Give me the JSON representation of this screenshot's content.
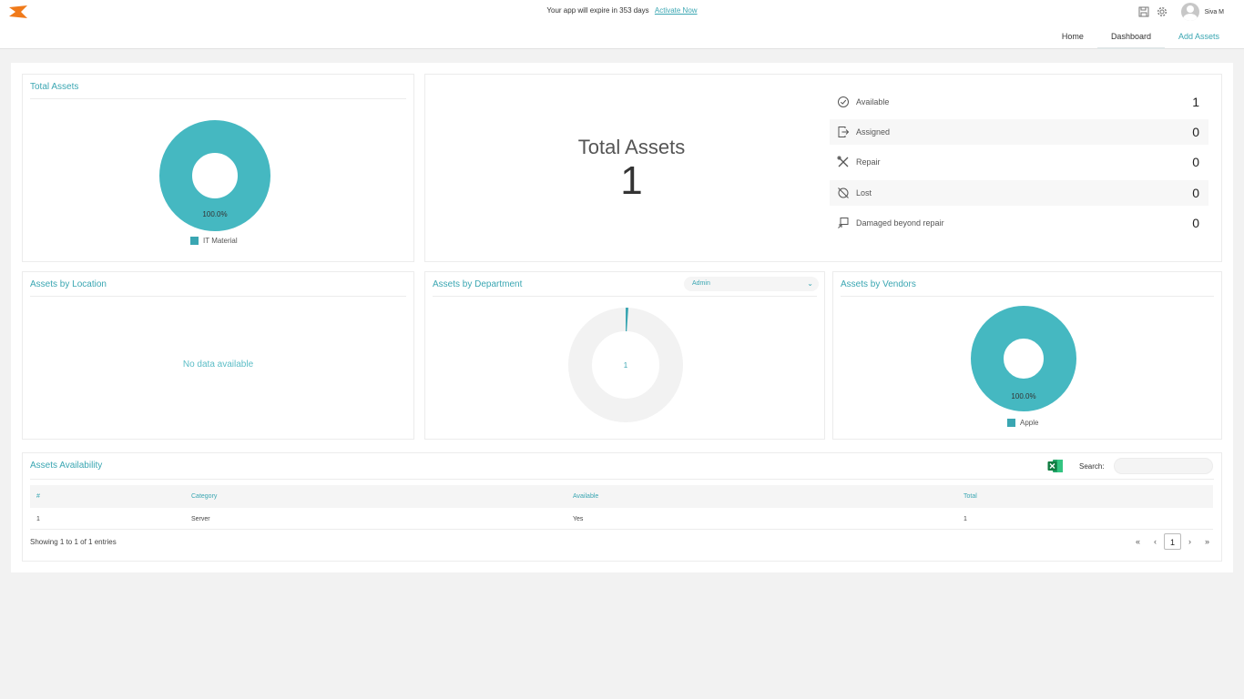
{
  "topbar": {
    "expire_text": "Your app will expire in 353 days",
    "activate_link": "Activate Now",
    "user_name": "Siva M",
    "icons": [
      "logo-icon",
      "save-icon",
      "gear-icon",
      "avatar"
    ]
  },
  "nav": {
    "home": "Home",
    "dashboard": "Dashboard",
    "add_assets": "Add Assets"
  },
  "colors": {
    "accent": "#3aa6b2",
    "donut_fill": "#45b8c1",
    "donut_track": "#f2f2f2"
  },
  "total_assets_card": {
    "title": "Total Assets",
    "pie_label": "100.0%",
    "legend": "IT Material"
  },
  "summary": {
    "title": "Total Assets",
    "count": "1",
    "statuses": [
      {
        "label": "Available",
        "value": "1",
        "icon": "check-circle-icon"
      },
      {
        "label": "Assigned",
        "value": "0",
        "icon": "assign-icon"
      },
      {
        "label": "Repair",
        "value": "0",
        "icon": "tools-icon"
      },
      {
        "label": "Lost",
        "value": "0",
        "icon": "lost-icon"
      },
      {
        "label": "Damaged beyond repair",
        "value": "0",
        "icon": "damaged-icon"
      }
    ]
  },
  "location_card": {
    "title": "Assets by Location",
    "empty_text": "No data available"
  },
  "department_card": {
    "title": "Assets by Department",
    "selected": "Admin",
    "center_value": "1"
  },
  "vendors_card": {
    "title": "Assets by Vendors",
    "pie_label": "100.0%",
    "legend": "Apple"
  },
  "availability": {
    "title": "Assets Availability",
    "search_label": "Search:",
    "search_value": "",
    "columns": [
      "#",
      "Category",
      "Available",
      "Total"
    ],
    "rows": [
      [
        "1",
        "Server",
        "Yes",
        "1"
      ]
    ],
    "entries_text": "Showing 1 to 1 of 1 entries",
    "pager": {
      "first": "«",
      "prev": "‹",
      "current": "1",
      "next": "›",
      "last": "»"
    }
  }
}
